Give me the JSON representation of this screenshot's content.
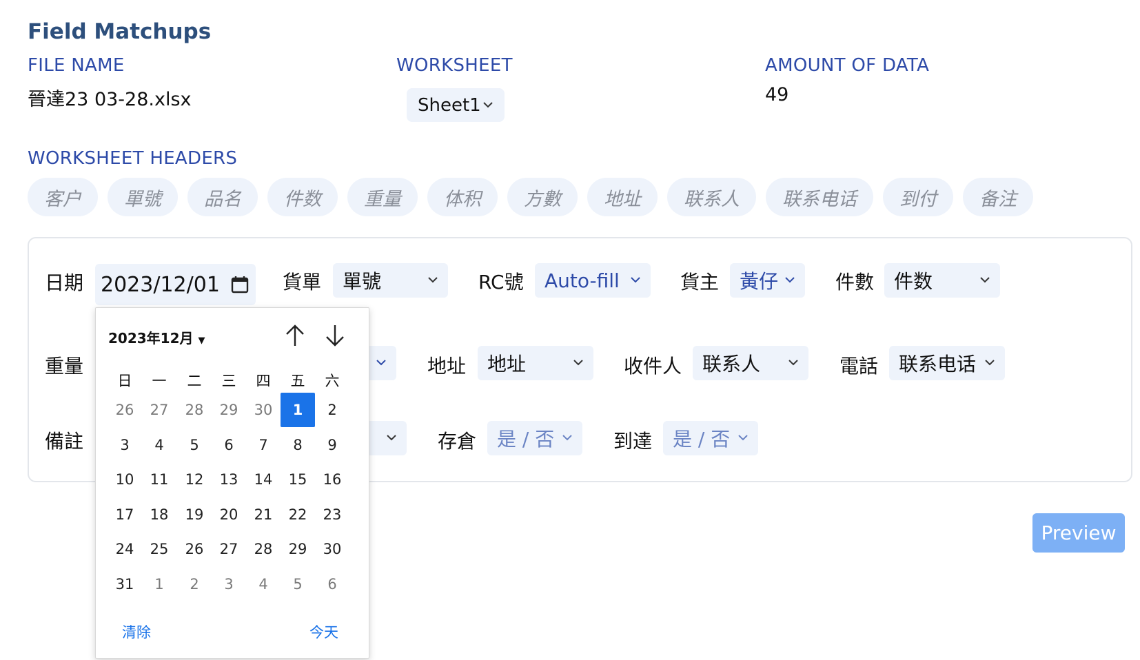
{
  "title": "Field Matchups",
  "file": {
    "label": "FILE NAME",
    "value": "晉達23 03-28.xlsx"
  },
  "worksheet": {
    "label": "WORKSHEET",
    "value": "Sheet1"
  },
  "amount": {
    "label": "AMOUNT OF DATA",
    "value": "49"
  },
  "headers": {
    "label": "WORKSHEET HEADERS",
    "items": [
      "客户",
      "單號",
      "品名",
      "件数",
      "重量",
      "体积",
      "方數",
      "地址",
      "联系人",
      "联系电话",
      "到付",
      "备注"
    ]
  },
  "fields": {
    "date": {
      "label": "日期",
      "value": "2023/12/01"
    },
    "bill": {
      "label": "貨單",
      "value": "單號"
    },
    "rc": {
      "label": "RC號",
      "value": "Auto-fill"
    },
    "owner": {
      "label": "貨主",
      "value": "黃仔"
    },
    "count": {
      "label": "件數",
      "value": "件数"
    },
    "weight": {
      "label": "重量"
    },
    "address": {
      "label": "地址",
      "value": "地址"
    },
    "receiver": {
      "label": "收件人",
      "value": "联系人"
    },
    "phone": {
      "label": "電話",
      "value": "联系电话"
    },
    "remark": {
      "label": "備註"
    },
    "storage": {
      "label": "存倉",
      "value": "是 / 否"
    },
    "arrive": {
      "label": "到達",
      "value": "是 / 否"
    }
  },
  "calendar": {
    "month": "2023年12月",
    "weekdays": [
      "日",
      "一",
      "二",
      "三",
      "四",
      "五",
      "六"
    ],
    "weeks": [
      [
        "26",
        "27",
        "28",
        "29",
        "30",
        "1",
        "2"
      ],
      [
        "3",
        "4",
        "5",
        "6",
        "7",
        "8",
        "9"
      ],
      [
        "10",
        "11",
        "12",
        "13",
        "14",
        "15",
        "16"
      ],
      [
        "17",
        "18",
        "19",
        "20",
        "21",
        "22",
        "23"
      ],
      [
        "24",
        "25",
        "26",
        "27",
        "28",
        "29",
        "30"
      ],
      [
        "31",
        "1",
        "2",
        "3",
        "4",
        "5",
        "6"
      ]
    ],
    "selected": "1",
    "clear": "清除",
    "today": "今天"
  },
  "preview_label": "Preview",
  "colors": {
    "accent": "#2d4aa8",
    "title": "#2d4f7c",
    "field_bg": "#eef3fb",
    "preview": "#7db0f5",
    "selected_day": "#1a73e8"
  }
}
